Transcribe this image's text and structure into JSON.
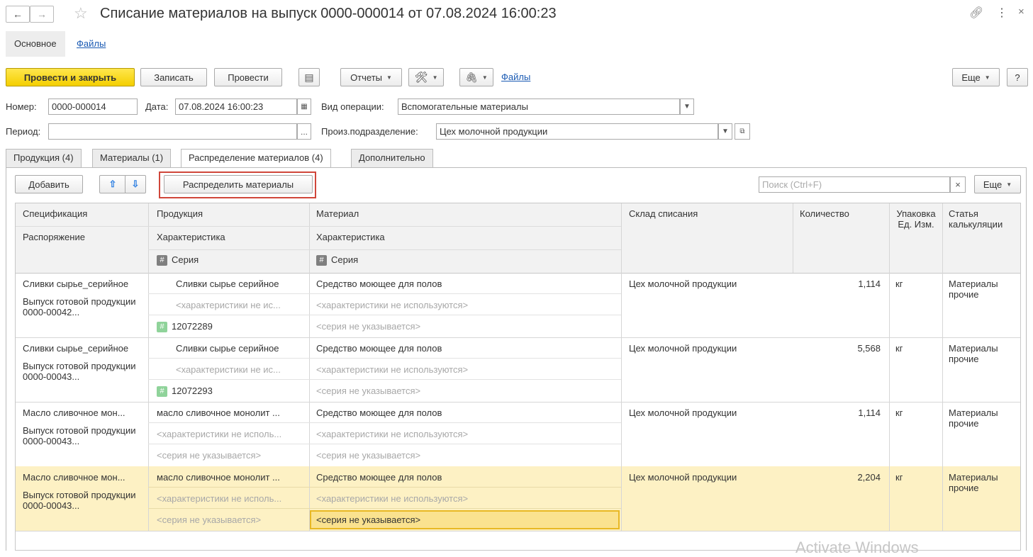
{
  "window": {
    "title": "Списание материалов на выпуск 0000-000014 от 07.08.2024 16:00:23"
  },
  "top_tabs": [
    {
      "label": "Основное"
    },
    {
      "label": "Файлы"
    }
  ],
  "toolbar": {
    "post_close": "Провести и закрыть",
    "save": "Записать",
    "post": "Провести",
    "reports": "Отчеты",
    "files_link": "Файлы",
    "more": "Еще",
    "help": "?"
  },
  "form": {
    "number_label": "Номер:",
    "number_value": "0000-000014",
    "date_label": "Дата:",
    "date_value": "07.08.2024 16:00:23",
    "operation_label": "Вид операции:",
    "operation_value": "Вспомогательные материалы",
    "period_label": "Период:",
    "period_value": "",
    "period_btn": "...",
    "division_label": "Произ.подразделение:",
    "division_value": "Цех молочной продукции"
  },
  "tabs": [
    {
      "label": "Продукция (4)"
    },
    {
      "label": "Материалы (1)"
    },
    {
      "label": "Распределение материалов (4)"
    },
    {
      "label": "Дополнительно"
    }
  ],
  "grid_toolbar": {
    "add": "Добавить",
    "distribute": "Распределить материалы",
    "search_placeholder": "Поиск (Ctrl+F)",
    "clear": "×",
    "more": "Еще"
  },
  "columns": {
    "spec": "Спецификация",
    "order": "Распоряжение",
    "product": "Продукция",
    "product_char": "Характеристика",
    "product_series": "Серия",
    "material": "Материал",
    "material_char": "Характеристика",
    "material_series": "Серия",
    "warehouse": "Склад списания",
    "quantity": "Количество",
    "package": "Упаковка Ед. Изм.",
    "cost_item": "Статья калькуляции"
  },
  "rows": [
    {
      "spec": "Сливки сырье_серийное",
      "order": "Выпуск готовой продукции 0000-00042...",
      "product": "Сливки сырье серийное",
      "product_char": "<характеристики не ис...",
      "product_series": "12072289",
      "material": "Средство моющее для полов",
      "material_char": "<характеристики не используются>",
      "material_series": "<серия не указывается>",
      "warehouse": "Цех молочной продукции",
      "quantity": "1,114",
      "unit": "кг",
      "cost_item": "Материалы прочие"
    },
    {
      "spec": "Сливки сырье_серийное",
      "order": "Выпуск готовой продукции 0000-00043...",
      "product": "Сливки сырье серийное",
      "product_char": "<характеристики не ис...",
      "product_series": "12072293",
      "material": "Средство моющее для полов",
      "material_char": "<характеристики не используются>",
      "material_series": "<серия не указывается>",
      "warehouse": "Цех молочной продукции",
      "quantity": "5,568",
      "unit": "кг",
      "cost_item": "Материалы прочие"
    },
    {
      "spec": "Масло сливочное мон...",
      "order": "Выпуск готовой продукции 0000-00043...",
      "product": "масло сливочное монолит ...",
      "product_char": "<характеристики не исполь...",
      "product_series": "<серия не указывается>",
      "material": "Средство моющее для полов",
      "material_char": "<характеристики не используются>",
      "material_series": "<серия не указывается>",
      "warehouse": "Цех молочной продукции",
      "quantity": "1,114",
      "unit": "кг",
      "cost_item": "Материалы прочие"
    },
    {
      "spec": "Масло сливочное мон...",
      "order": "Выпуск готовой продукции 0000-00043...",
      "product": "масло сливочное монолит ...",
      "product_char": "<характеристики не исполь...",
      "product_series": "<серия не указывается>",
      "material": "Средство моющее для полов",
      "material_char": "<характеристики не используются>",
      "material_series": "<серия не указывается>",
      "warehouse": "Цех молочной продукции",
      "quantity": "2,204",
      "unit": "кг",
      "cost_item": "Материалы прочие"
    }
  ],
  "watermark": "Activate Windows",
  "colors": {
    "primary_button": "#f4cf00",
    "selected_row": "#fdf1c4",
    "highlight_box": "#d0463a",
    "link": "#1a5ab3"
  }
}
